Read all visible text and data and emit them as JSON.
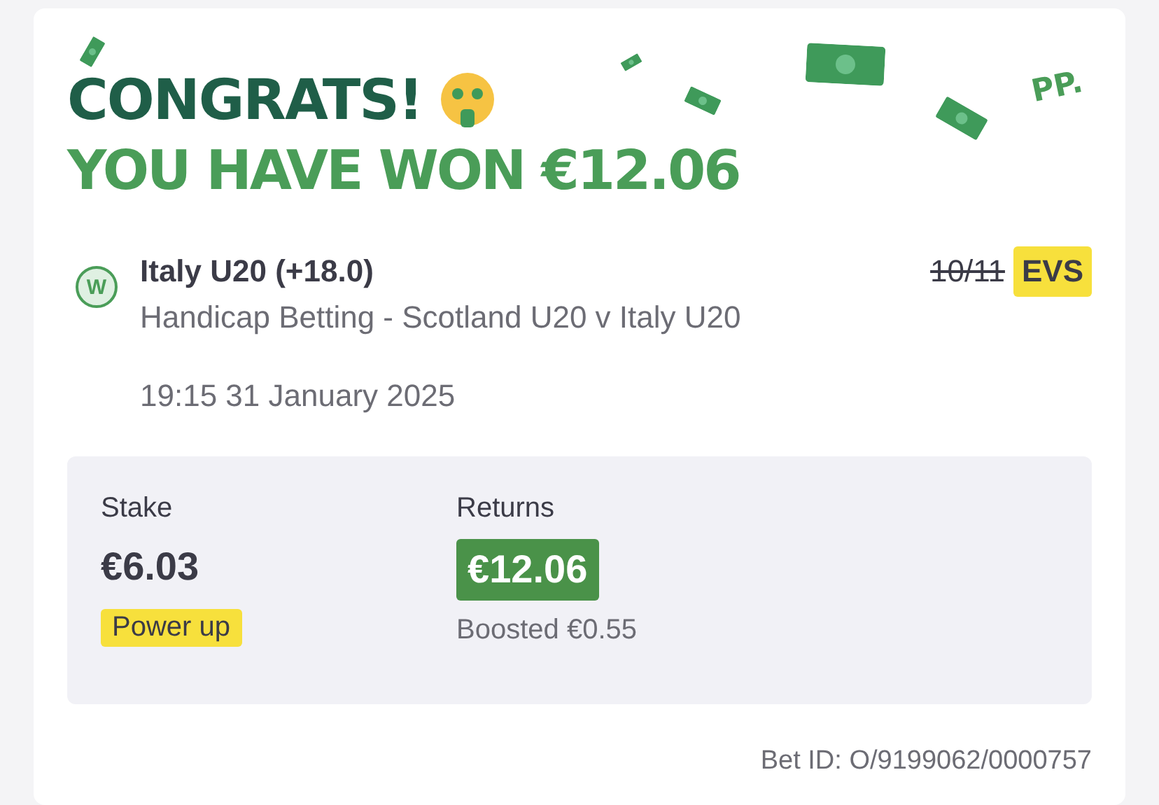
{
  "header": {
    "title": "CONGRATS!",
    "subtitle": "YOU HAVE WON €12.06",
    "logo": "PP."
  },
  "bet": {
    "result_badge": "W",
    "selection": "Italy U20 (+18.0)",
    "previous_odds": "10/11",
    "odds": "EVS",
    "market": "Handicap Betting - Scotland U20 v Italy U20",
    "time": "19:15 31 January 2025"
  },
  "summary": {
    "stake_label": "Stake",
    "stake": "€6.03",
    "tag": "Power up",
    "returns_label": "Returns",
    "returns": "€12.06",
    "boost": "Boosted €0.55"
  },
  "bet_id": "Bet ID: O/9199062/0000757"
}
